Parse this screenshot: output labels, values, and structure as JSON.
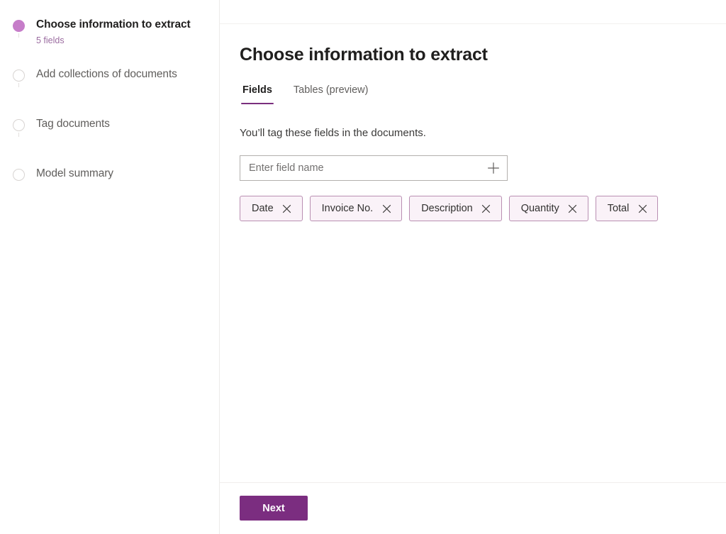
{
  "sidebar": {
    "steps": [
      {
        "label": "Choose information to extract",
        "sub": "5 fields",
        "state": "current"
      },
      {
        "label": "Add collections of documents",
        "sub": "",
        "state": "upcoming"
      },
      {
        "label": "Tag documents",
        "sub": "",
        "state": "upcoming"
      },
      {
        "label": "Model summary",
        "sub": "",
        "state": "upcoming"
      }
    ]
  },
  "main": {
    "title": "Choose information to extract",
    "tabs": [
      {
        "label": "Fields",
        "active": true
      },
      {
        "label": "Tables (preview)",
        "active": false
      }
    ],
    "subtitle": "You’ll tag these fields in the documents.",
    "field_input": {
      "value": "",
      "placeholder": "Enter field name",
      "add_icon": "plus-icon"
    },
    "chips": [
      {
        "label": "Date",
        "remove_icon": "close-icon"
      },
      {
        "label": "Invoice No.",
        "remove_icon": "close-icon"
      },
      {
        "label": "Description",
        "remove_icon": "close-icon"
      },
      {
        "label": "Quantity",
        "remove_icon": "close-icon"
      },
      {
        "label": "Total",
        "remove_icon": "close-icon"
      }
    ]
  },
  "footer": {
    "next_label": "Next"
  },
  "colors": {
    "accent": "#7b2d80",
    "active_step_dot": "#c67dc9",
    "chip_border": "#b98fb2",
    "chip_fill": "#faf2f8",
    "sub_text": "#9b6ca0"
  }
}
